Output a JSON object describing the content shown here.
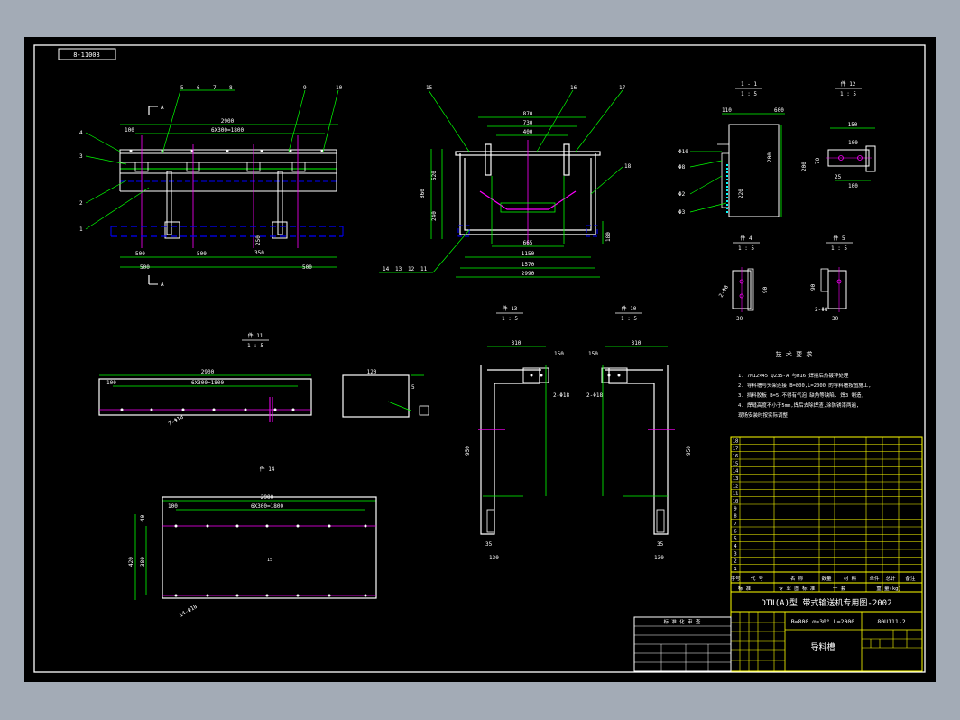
{
  "drawing": {
    "code_box": "8-11008",
    "background": "#000000",
    "frame_color": "#ffffff",
    "colors": {
      "outline": "#ffffff",
      "dimension": "#00ff00",
      "hidden": "#0000ff",
      "center": "#ff00ff",
      "title_block": "#ffff00",
      "text": "#ff00ff",
      "section_mark": "#ffff00"
    }
  },
  "main_view": {
    "dim_overall": "2900",
    "dim_span": "6X300=1800",
    "dim_left": "100",
    "dim_bottom_1": "500",
    "dim_bottom_2": "500",
    "dim_bottom_3": "500",
    "dim_bottom_4": "500",
    "dim_h1": "350",
    "dim_h2": "250",
    "callouts": [
      "1",
      "2",
      "3",
      "4",
      "5",
      "6",
      "7",
      "8",
      "9",
      "10"
    ],
    "section_top": "A",
    "section_bottom": "A"
  },
  "section_view": {
    "dim_top_1": "870",
    "dim_top_2": "730",
    "dim_top_3": "400",
    "dim_bottom_1": "1150",
    "dim_bottom_2": "1570",
    "dim_bottom_3": "2990",
    "dim_bottom_4": "665",
    "dim_left_1": "520",
    "dim_left_2": "860",
    "dim_left_3": "240",
    "dim_right_1": "180",
    "callouts": [
      "15",
      "16",
      "17",
      "18",
      "14",
      "13",
      "12",
      "11"
    ]
  },
  "detail_1": {
    "label": "1 - 1",
    "scale": "1 : 5",
    "dim_top": "600",
    "dim_left": "110",
    "dim_h": "200",
    "dim_h2": "220",
    "callouts": [
      "Φ10",
      "Φ8",
      "Φ2",
      "Φ3"
    ]
  },
  "detail_2": {
    "label": "件 12",
    "scale": "1 : 5",
    "dim_top": "150",
    "dim_sub": "100",
    "dim_h": "70",
    "dim_h2": "200",
    "dim_b1": "25",
    "dim_b2": "100"
  },
  "detail_3": {
    "label": "件 4",
    "scale": "1 : 5",
    "dim_w": "30",
    "dim_h": "90",
    "dim_hole": "2-Φ8"
  },
  "detail_4": {
    "label": "件 5",
    "scale": "1 : 5",
    "dim_w": "30",
    "dim_h": "90",
    "dim_hole": "2-Φ8"
  },
  "part_13": {
    "label": "件 13",
    "scale": "1 : 5",
    "dim_top": "310",
    "dim_flange": "150",
    "dim_height": "950",
    "dim_b1": "35",
    "dim_b2": "130",
    "dim_hole": "2-Φ18"
  },
  "part_10": {
    "label": "件 10",
    "scale": "1 : 5",
    "dim_top": "310",
    "dim_flange": "150",
    "dim_height": "950",
    "dim_b1": "35",
    "dim_b2": "130",
    "dim_hole": "2-Φ18"
  },
  "part_11": {
    "label": "件 11",
    "scale": "1 : 5",
    "dim_overall": "2900",
    "dim_span": "6X300=1800",
    "dim_left": "100",
    "dim_hole": "7-Φ18",
    "side_w": "120",
    "side_h": "5"
  },
  "part_14": {
    "label": "件 14",
    "dim_overall": "2900",
    "dim_span": "6X300=1800",
    "dim_left": "100",
    "dim_h1": "380",
    "dim_h2": "420",
    "dim_h3": "40",
    "dim_hole": "14-Φ18"
  },
  "tech_req": {
    "title": "技 术 要 求",
    "lines": [
      "1. 7M12×45  Q235-A 与H16 焊接后热镀锌处理",
      "2. 导料槽与头架连接 B=800,L=2000 的导料槽按图施工,",
      "3. 挡料胶板 B=5,不得有气泡,缺角等缺陷. 焊3 制造,",
      "4. 焊缝高度不小于5mm,焊后去除焊渣,涂防锈漆两遍,",
      "   现场安装时按实际调整."
    ]
  },
  "parts_table": {
    "rows": [
      [
        "18",
        "",
        "",
        "",
        "",
        "",
        ""
      ],
      [
        "17",
        "",
        "",
        "",
        "",
        "",
        ""
      ],
      [
        "16",
        "",
        "",
        "",
        "",
        "",
        ""
      ],
      [
        "15",
        "",
        "",
        "",
        "",
        "",
        ""
      ],
      [
        "14",
        "",
        "",
        "",
        "",
        "",
        ""
      ],
      [
        "13",
        "",
        "",
        "",
        "",
        "",
        ""
      ],
      [
        "12",
        "",
        "",
        "",
        "",
        "",
        ""
      ],
      [
        "11",
        "",
        "",
        "",
        "",
        "",
        ""
      ],
      [
        "10",
        "",
        "",
        "",
        "",
        "",
        ""
      ],
      [
        "9",
        "",
        "",
        "",
        "",
        "",
        ""
      ],
      [
        "8",
        "",
        "",
        "",
        "",
        "",
        ""
      ],
      [
        "7",
        "",
        "",
        "",
        "",
        "",
        ""
      ],
      [
        "6",
        "",
        "",
        "",
        "",
        "",
        ""
      ],
      [
        "5",
        "",
        "",
        "",
        "",
        "",
        ""
      ],
      [
        "4",
        "",
        "",
        "",
        "",
        "",
        ""
      ],
      [
        "3",
        "",
        "",
        "",
        "",
        "",
        ""
      ],
      [
        "2",
        "",
        "",
        "",
        "",
        "",
        ""
      ],
      [
        "1",
        "",
        "",
        "",
        "",
        "",
        ""
      ]
    ],
    "header": [
      "序号",
      "代 号",
      "名 称",
      "数量",
      "材 料",
      "单件",
      "总计",
      "备注"
    ],
    "header_2": [
      "标 准",
      "专 业 图 标 准",
      "一 套",
      "重 量(kg)"
    ]
  },
  "title_block": {
    "series": "DTⅡ(A)型 带式输送机专用图-2002",
    "spec": "B=800 α=30° L=2000",
    "code": "80U111-2",
    "name": "导料槽"
  },
  "revision_table": {
    "title": "标 准 化 审 查",
    "rows": [
      "",
      "",
      "",
      "",
      ""
    ]
  }
}
